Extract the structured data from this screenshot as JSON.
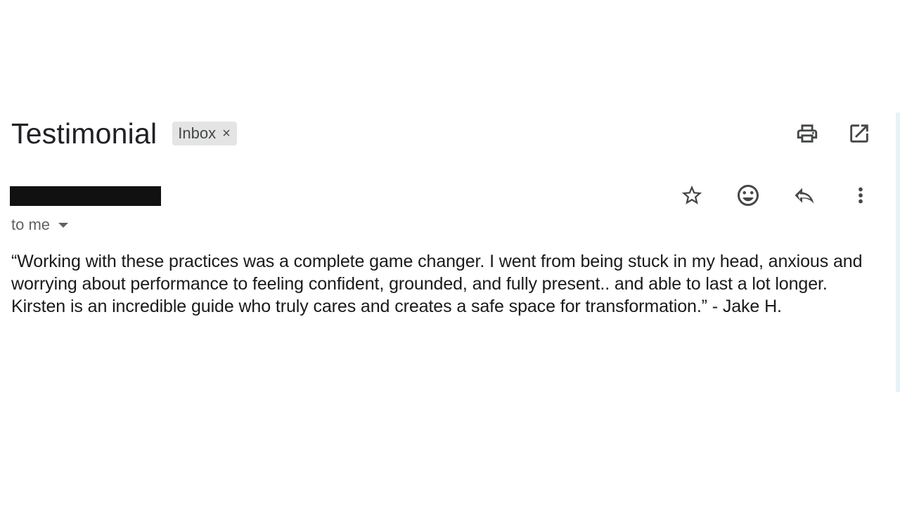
{
  "email": {
    "subject": "Testimonial",
    "label": "Inbox",
    "label_remove": "×",
    "recipient": "to me",
    "body": "“Working with these practices was a complete game changer. I went from being stuck in my head, anxious and worrying about performance to feeling confident, grounded, and fully present.. and able to last a lot longer. Kirsten is an incredible guide who truly cares and creates a safe space for transformation.” - Jake H."
  },
  "header_actions": [
    {
      "icon": "print-icon"
    },
    {
      "icon": "open-in-new-window-icon"
    }
  ],
  "message_actions": [
    {
      "icon": "star-icon"
    },
    {
      "icon": "emoji-reaction-icon"
    },
    {
      "icon": "reply-icon"
    },
    {
      "icon": "more-vert-icon"
    }
  ],
  "colors": {
    "icon": "#444746",
    "chip_bg": "#e4e4e4",
    "redaction": "#111111"
  }
}
